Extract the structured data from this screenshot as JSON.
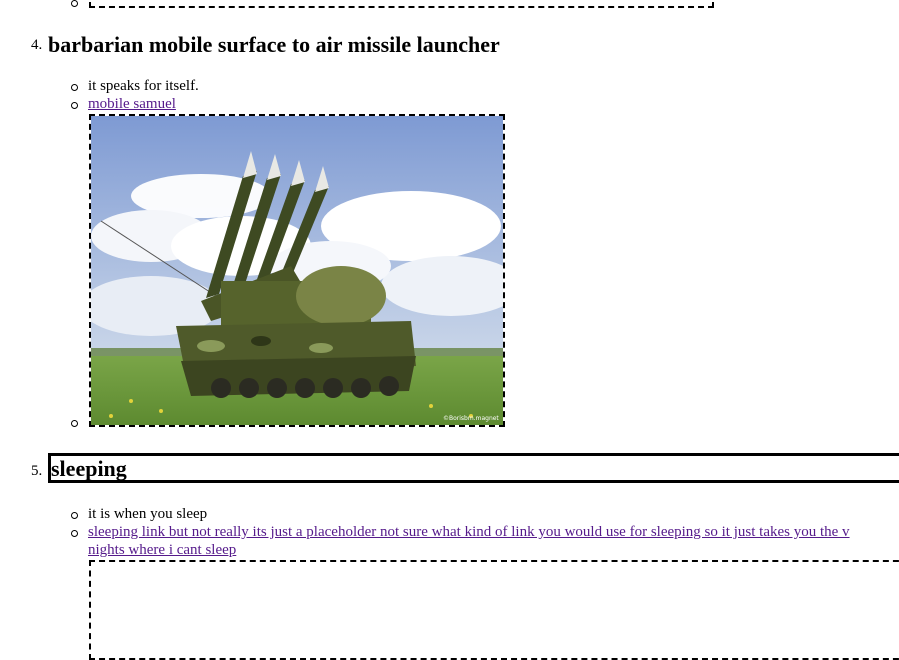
{
  "items": [
    {
      "number": "4.",
      "title": "barbarian mobile surface to air missile launcher",
      "description": "it speaks for itself.",
      "link_text": "mobile samuel",
      "image_alt": "green mobile surface-to-air missile launcher vehicle on grass under a cloudy sky",
      "image_watermark": "©Borisbm.magnet"
    },
    {
      "number": "5.",
      "title": "sleeping",
      "description": "it is when you sleep",
      "link_text_line1": "sleeping link but not really its just a placeholder not sure what kind of link you would use for sleeping so it just takes you the v",
      "link_text_line2": "nights where i cant sleep"
    }
  ],
  "colors": {
    "link": "#551a8b",
    "sky_top": "#8fa8d8",
    "grass": "#6f9a3c",
    "vehicle": "#4f5a2a"
  }
}
